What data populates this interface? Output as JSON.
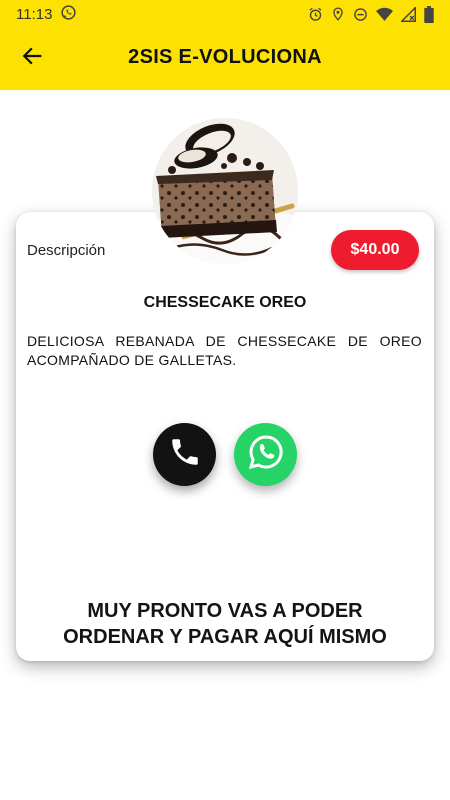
{
  "status_bar": {
    "time": "11:13",
    "icons": [
      "whatsapp-notification-icon",
      "alarm-icon",
      "location-icon",
      "do-not-disturb-icon",
      "wifi-icon",
      "signal-icon",
      "battery-icon"
    ]
  },
  "app_bar": {
    "title": "2SIS E-VOLUCIONA",
    "back_icon": "arrow-back-icon",
    "color": "#fde100"
  },
  "product": {
    "description_label": "Descripción",
    "price": "$40.00",
    "price_color": "#ee1c2e",
    "name": "CHESSECAKE OREO",
    "description": "DELICIOSA REBANADA DE CHESSECAKE DE OREO ACOMPAÑADO DE GALLETAS.",
    "image": "oreo-cheesecake-photo"
  },
  "contact": {
    "call_icon": "phone-icon",
    "whatsapp_icon": "whatsapp-icon",
    "whatsapp_color": "#25d366"
  },
  "footer": {
    "line1": "MUY PRONTO VAS A PODER",
    "line2": "ORDENAR Y PAGAR AQUÍ MISMO"
  }
}
